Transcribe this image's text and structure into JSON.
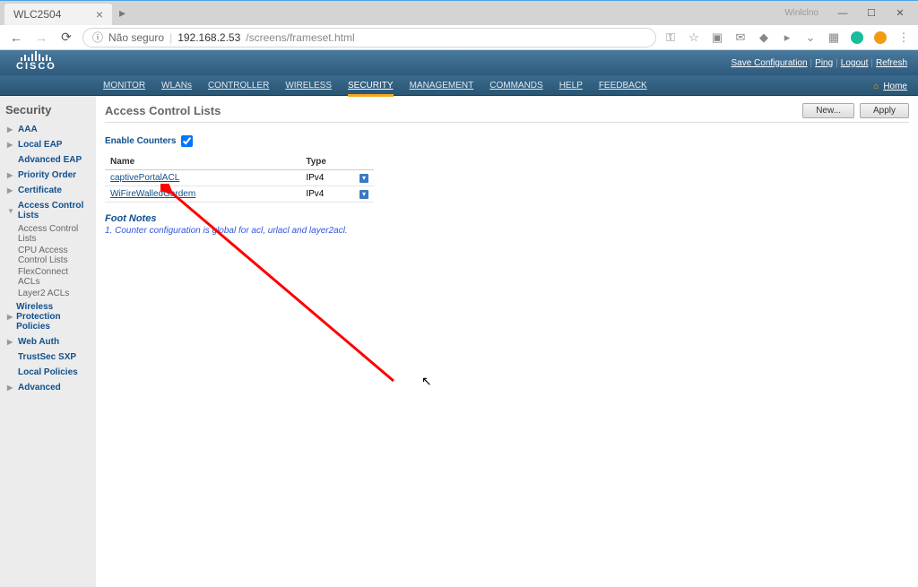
{
  "browser": {
    "tab_title": "WLC2504",
    "window_label": "Winlclno",
    "insecure_label": "Não seguro",
    "url_host": "192.168.2.53",
    "url_path": "/screens/frameset.html"
  },
  "cisco": {
    "brand": "CISCO",
    "actions": {
      "save": "Save Configuration",
      "ping": "Ping",
      "logout": "Logout",
      "refresh": "Refresh",
      "home": "Home"
    }
  },
  "nav": {
    "monitor": "MONITOR",
    "wlans": "WLANs",
    "controller": "CONTROLLER",
    "wireless": "WIRELESS",
    "security": "SECURITY",
    "management": "MANAGEMENT",
    "commands": "COMMANDS",
    "help": "HELP",
    "feedback": "FEEDBACK"
  },
  "sidebar": {
    "title": "Security",
    "items": [
      {
        "label": "AAA",
        "expand": true
      },
      {
        "label": "Local EAP",
        "expand": true
      },
      {
        "label": "Advanced EAP",
        "expand": false
      },
      {
        "label": "Priority Order",
        "expand": true
      },
      {
        "label": "Certificate",
        "expand": true
      },
      {
        "label": "Access Control Lists",
        "expand": true,
        "open": true,
        "subs": [
          "Access Control Lists",
          "CPU Access Control Lists",
          "FlexConnect ACLs",
          "Layer2 ACLs"
        ]
      },
      {
        "label": "Wireless Protection Policies",
        "expand": true
      },
      {
        "label": "Web Auth",
        "expand": true
      },
      {
        "label": "TrustSec SXP",
        "expand": false
      },
      {
        "label": "Local Policies",
        "expand": false
      },
      {
        "label": "Advanced",
        "expand": true
      }
    ]
  },
  "page": {
    "title": "Access Control Lists",
    "new_btn": "New...",
    "apply_btn": "Apply",
    "enable_label": "Enable Counters",
    "table": {
      "col_name": "Name",
      "col_type": "Type",
      "rows": [
        {
          "name": "captivePortalACL",
          "type": "IPv4"
        },
        {
          "name": "WiFireWalledGardem",
          "type": "IPv4"
        }
      ]
    },
    "footnotes": {
      "title": "Foot Notes",
      "text": "1. Counter configuration is global for acl, urlacl and layer2acl."
    }
  }
}
